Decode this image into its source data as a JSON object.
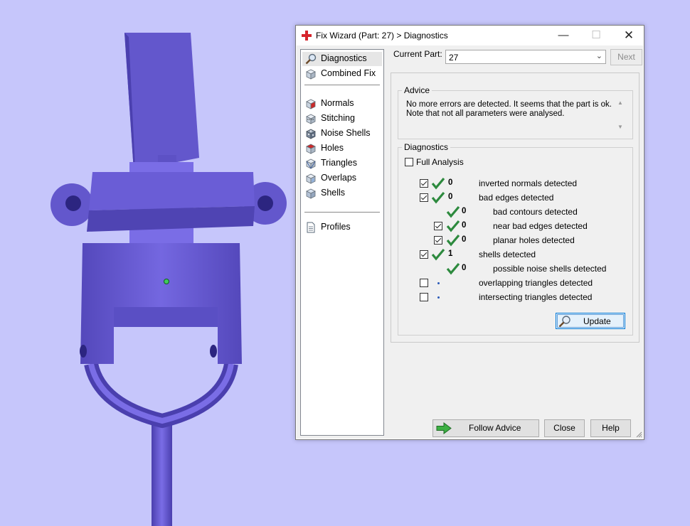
{
  "colors": {
    "background": "#c6c6fb",
    "model_body": "#6a5fd3",
    "model_shadow": "#4a3fae",
    "check_green": "#2d8a3e",
    "accent": "#0078d7"
  },
  "dialog": {
    "title": "Fix Wizard (Part: 27) > Diagnostics",
    "icon": "red-cross-icon"
  },
  "nav": {
    "items": [
      {
        "label": "Diagnostics",
        "icon": "magnifier-icon",
        "selected": true
      },
      {
        "label": "Combined Fix",
        "icon": "cube-icon"
      },
      {
        "label": "Normals",
        "icon": "normals-cube-icon"
      },
      {
        "label": "Stitching",
        "icon": "stitching-cube-icon"
      },
      {
        "label": "Noise Shells",
        "icon": "noise-shells-icon"
      },
      {
        "label": "Holes",
        "icon": "holes-cube-icon"
      },
      {
        "label": "Triangles",
        "icon": "triangles-cube-icon"
      },
      {
        "label": "Overlaps",
        "icon": "overlaps-cube-icon"
      },
      {
        "label": "Shells",
        "icon": "shells-cube-icon"
      },
      {
        "label": "Profiles",
        "icon": "document-icon"
      }
    ]
  },
  "current_part": {
    "label": "Current Part:",
    "value": "27"
  },
  "next_label": "Next",
  "advice": {
    "title": "Advice",
    "line1": "No more errors are detected. It seems that the part is ok.",
    "line2": "Note that not all parameters were analysed."
  },
  "diagnostics": {
    "title": "Diagnostics",
    "full_analysis": {
      "label": "Full Analysis",
      "checked": false
    },
    "rows": [
      {
        "label": "inverted normals detected",
        "value": "0",
        "checked": true,
        "status": "ok"
      },
      {
        "label": "bad edges detected",
        "value": "0",
        "checked": true,
        "status": "ok"
      },
      {
        "label": "bad contours detected",
        "value": "0",
        "status": "ok"
      },
      {
        "label": "near bad edges detected",
        "value": "0",
        "checked": true,
        "status": "ok"
      },
      {
        "label": "planar holes detected",
        "value": "0",
        "checked": true,
        "status": "ok"
      },
      {
        "label": "shells detected",
        "value": "1",
        "checked": true,
        "status": "ok"
      },
      {
        "label": "possible noise shells detected",
        "value": "0",
        "status": "ok"
      },
      {
        "label": "overlapping triangles detected",
        "checked": false,
        "status": "not-run"
      },
      {
        "label": "intersecting triangles detected",
        "checked": false,
        "status": "not-run"
      }
    ]
  },
  "buttons": {
    "update": "Update",
    "follow_advice": "Follow Advice",
    "close": "Close",
    "help": "Help"
  }
}
